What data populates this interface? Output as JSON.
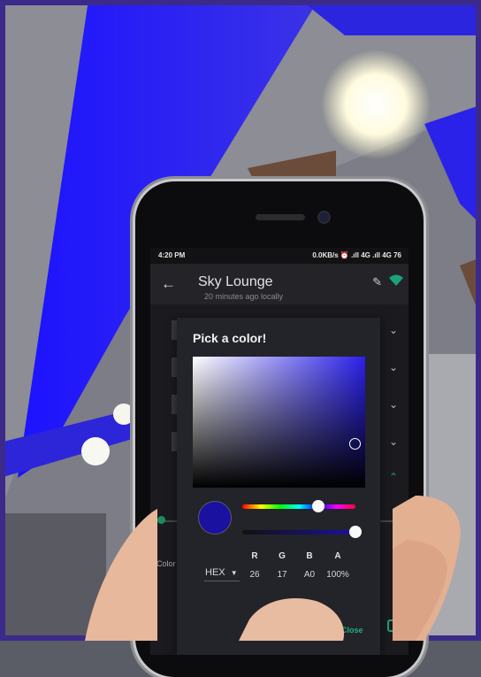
{
  "status_bar": {
    "time": "4:20 PM",
    "right": "0.0KB/s ⏰ .ıll 4G .ıll 4G 76"
  },
  "app_bar": {
    "title": "Sky Lounge"
  },
  "list": {
    "subtext": "20 minutes ago locally",
    "color_label": "Color"
  },
  "dialog": {
    "title": "Pick a color!",
    "color_hex": "#1A11A0",
    "mode": "HEX",
    "channels": [
      {
        "label": "R",
        "value": "26"
      },
      {
        "label": "G",
        "value": "17"
      },
      {
        "label": "B",
        "value": "A0"
      },
      {
        "label": "A",
        "value": "100%"
      }
    ],
    "hue_fraction": 0.67,
    "alpha_fraction": 1.0,
    "close_label": "Close"
  },
  "colors": {
    "accent": "#1aa27a",
    "ambient_light": "#2a1ee8"
  }
}
